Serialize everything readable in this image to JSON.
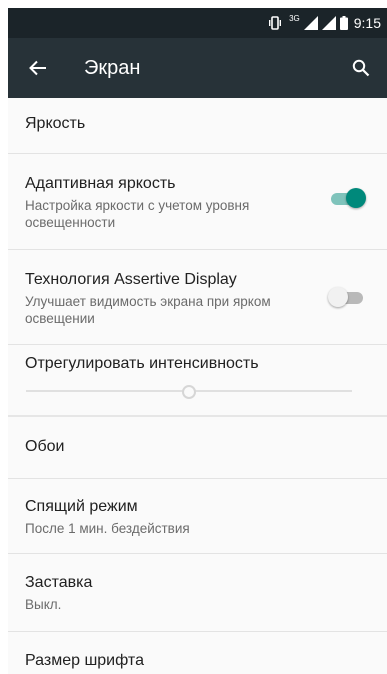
{
  "status_bar": {
    "network_label": "3G",
    "time": "9:15",
    "icons": [
      "vibrate-icon",
      "signal-icon",
      "signal-icon",
      "battery-icon"
    ]
  },
  "app_bar": {
    "title": "Экран",
    "back_icon": "arrow-back-icon",
    "search_icon": "search-icon",
    "background": "#273238"
  },
  "settings": {
    "brightness": {
      "title": "Яркость"
    },
    "adaptive_brightness": {
      "title": "Адаптивная яркость",
      "summary": "Настройка яркости с учетом уровня освещенности",
      "enabled": true
    },
    "assertive_display": {
      "title": "Технология Assertive Display",
      "summary": "Улучшает видимость экрана при ярком освещении",
      "enabled": false
    },
    "intensity": {
      "title": "Отрегулировать интенсивность",
      "value_fraction": 0.5,
      "enabled": false
    },
    "wallpaper": {
      "title": "Обои"
    },
    "sleep": {
      "title": "Спящий режим",
      "summary": "После 1 мин. бездействия"
    },
    "screensaver": {
      "title": "Заставка",
      "summary": "Выкл."
    },
    "font_size": {
      "title": "Размер шрифта"
    }
  },
  "accent_color": "#00897b"
}
